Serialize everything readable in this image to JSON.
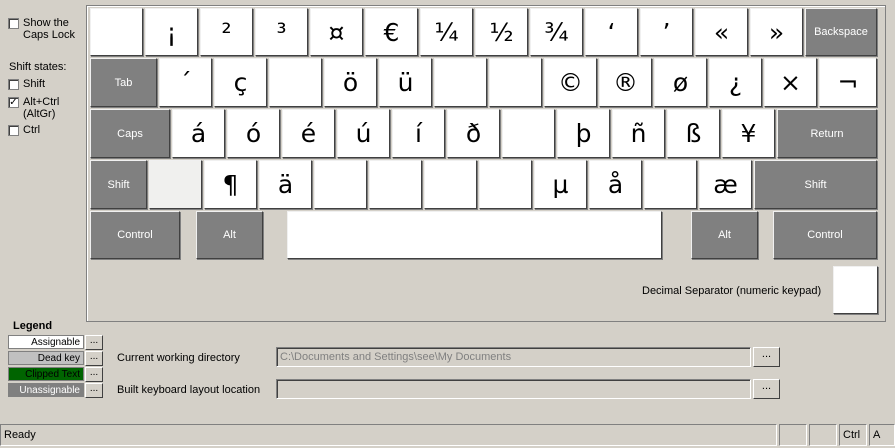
{
  "left_panel": {
    "show_caps_lock": "Show the Caps Lock",
    "shift_states_label": "Shift states:",
    "shift": "Shift",
    "alt_ctrl": "Alt+Ctrl (AltGr)",
    "ctrl": "Ctrl",
    "shift_checked": false,
    "alt_ctrl_checked": true,
    "ctrl_checked": false,
    "show_caps_checked": false
  },
  "keyboard": {
    "row1": [
      "",
      "¡",
      "²",
      "³",
      "¤",
      "€",
      "¼",
      "½",
      "¾",
      "‘",
      "’",
      "«",
      "»"
    ],
    "backspace": "Backspace",
    "tab": "Tab",
    "row2": [
      "´",
      "ç",
      "",
      "ö",
      "ü",
      "",
      "",
      "©",
      "®",
      "ø",
      "¿",
      "×",
      "¬"
    ],
    "caps": "Caps",
    "row3": [
      "á",
      "ó",
      "é",
      "ú",
      "í",
      "ð",
      "",
      "þ",
      "ñ",
      "ß",
      "¥"
    ],
    "return": "Return",
    "shift_left": "Shift",
    "row4": [
      "",
      "¶",
      "ä",
      "",
      "",
      "",
      "",
      "µ",
      "å",
      "",
      "æ"
    ],
    "shift_right": "Shift",
    "control_left": "Control",
    "alt_left": "Alt",
    "space": "",
    "alt_right": "Alt",
    "control_right": "Control",
    "decimal_label": "Decimal Separator (numeric keypad)",
    "decimal_value": ""
  },
  "legend": {
    "title": "Legend",
    "items": [
      {
        "label": "Assignable",
        "bg": "#ffffff",
        "fg": "#000000"
      },
      {
        "label": "Dead key",
        "bg": "#c0c0c0",
        "fg": "#000000"
      },
      {
        "label": "Clipped Text",
        "bg": "#006400",
        "fg": "#000000"
      },
      {
        "label": "Unassignable",
        "bg": "#808080",
        "fg": "#ffffff"
      }
    ],
    "button": "..."
  },
  "paths": {
    "cwd_label": "Current working directory",
    "cwd_value": "C:\\Documents and Settings\\see\\My Documents",
    "build_label": "Built keyboard layout location",
    "build_value": "",
    "browse": "..."
  },
  "status": {
    "text": "Ready",
    "ctrl": "Ctrl",
    "a": "A"
  }
}
